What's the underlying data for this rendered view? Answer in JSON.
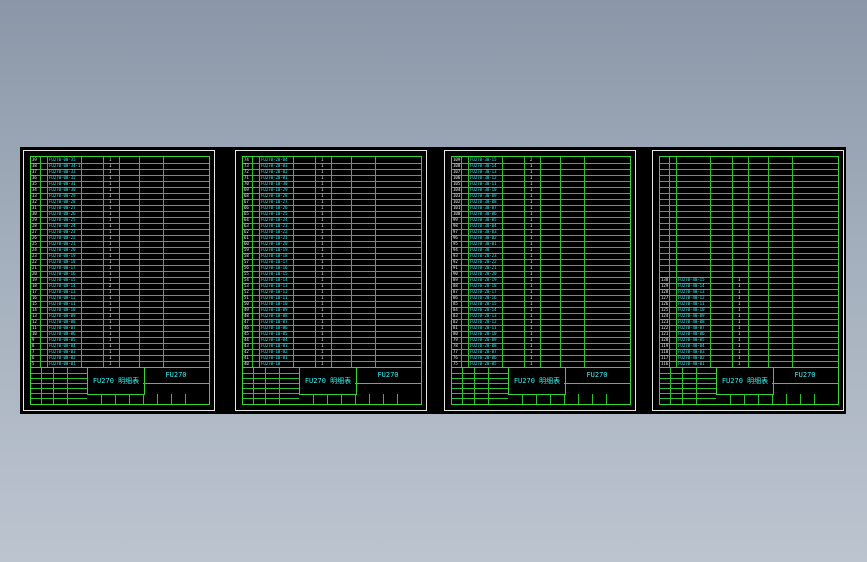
{
  "sheets": [
    {
      "title": "FU270 明细表",
      "code": "FU270",
      "rows": [
        {
          "no": "39",
          "code": "FU270-00-35",
          "name": "",
          "qty": "1"
        },
        {
          "no": "38",
          "code": "FU270-00-34-1",
          "name": "",
          "qty": "1"
        },
        {
          "no": "37",
          "code": "FU270-00-33",
          "name": "",
          "qty": "1"
        },
        {
          "no": "36",
          "code": "FU270-00-32",
          "name": "",
          "qty": "1"
        },
        {
          "no": "35",
          "code": "FU270-00-31",
          "name": "",
          "qty": "1"
        },
        {
          "no": "34",
          "code": "FU270-00-30",
          "name": "",
          "qty": "1"
        },
        {
          "no": "33",
          "code": "FU270-00-29",
          "name": "",
          "qty": "1"
        },
        {
          "no": "32",
          "code": "FU270-00-28",
          "name": "",
          "qty": "1"
        },
        {
          "no": "31",
          "code": "FU270-00-27",
          "name": "",
          "qty": "1"
        },
        {
          "no": "30",
          "code": "FU270-00-26",
          "name": "",
          "qty": "1"
        },
        {
          "no": "29",
          "code": "FU270-00-25",
          "name": "",
          "qty": "1"
        },
        {
          "no": "28",
          "code": "FU270-00-24",
          "name": "",
          "qty": "1"
        },
        {
          "no": "27",
          "code": "FU270-00-23",
          "name": "",
          "qty": "1"
        },
        {
          "no": "26",
          "code": "FU270-00-22",
          "name": "",
          "qty": "1"
        },
        {
          "no": "25",
          "code": "FU270-00-21",
          "name": "",
          "qty": "1"
        },
        {
          "no": "24",
          "code": "FU270-00-20",
          "name": "",
          "qty": "1"
        },
        {
          "no": "23",
          "code": "FU270-00-19",
          "name": "",
          "qty": "1"
        },
        {
          "no": "22",
          "code": "FU270-00-18",
          "name": "",
          "qty": "1"
        },
        {
          "no": "21",
          "code": "FU270-00-17",
          "name": "",
          "qty": "1"
        },
        {
          "no": "20",
          "code": "FU270-00-16",
          "name": "",
          "qty": "1"
        },
        {
          "no": "19",
          "code": "FU270-00-15",
          "name": "",
          "qty": "1"
        },
        {
          "no": "18",
          "code": "FU270-00-14",
          "name": "",
          "qty": "2"
        },
        {
          "no": "17",
          "code": "FU270-00-13",
          "name": "",
          "qty": "1"
        },
        {
          "no": "16",
          "code": "FU270-00-12",
          "name": "",
          "qty": "1"
        },
        {
          "no": "15",
          "code": "FU270-00-11",
          "name": "",
          "qty": "1"
        },
        {
          "no": "14",
          "code": "FU270-00-10",
          "name": "",
          "qty": "1"
        },
        {
          "no": "13",
          "code": "FU270-00-09",
          "name": "",
          "qty": "1"
        },
        {
          "no": "12",
          "code": "FU270-00-08",
          "name": "",
          "qty": "1"
        },
        {
          "no": "11",
          "code": "FU270-00-07",
          "name": "",
          "qty": "1"
        },
        {
          "no": "10",
          "code": "FU270-00-06",
          "name": "",
          "qty": "1"
        },
        {
          "no": "9",
          "code": "FU270-00-05",
          "name": "",
          "qty": "1"
        },
        {
          "no": "8",
          "code": "FU270-00-04",
          "name": "",
          "qty": "1"
        },
        {
          "no": "7",
          "code": "FU270-00-03",
          "name": "",
          "qty": "1"
        },
        {
          "no": "6",
          "code": "FU270-00-02",
          "name": "",
          "qty": "1"
        },
        {
          "no": "5",
          "code": "FU270-00-01",
          "name": "",
          "qty": "1"
        }
      ]
    },
    {
      "title": "FU270 明细表",
      "code": "FU270",
      "rows": [
        {
          "no": "74",
          "code": "FU270-20-04",
          "name": "",
          "qty": "1"
        },
        {
          "no": "73",
          "code": "FU270-20-03",
          "name": "",
          "qty": "1"
        },
        {
          "no": "72",
          "code": "FU270-20-02",
          "name": "",
          "qty": "1"
        },
        {
          "no": "71",
          "code": "FU270-20-01",
          "name": "",
          "qty": "1"
        },
        {
          "no": "70",
          "code": "FU270-10-30",
          "name": "",
          "qty": "1"
        },
        {
          "no": "69",
          "code": "FU270-10-29",
          "name": "",
          "qty": "1"
        },
        {
          "no": "68",
          "code": "FU270-10-28",
          "name": "",
          "qty": "1"
        },
        {
          "no": "67",
          "code": "FU270-10-27",
          "name": "",
          "qty": "1"
        },
        {
          "no": "66",
          "code": "FU270-10-26",
          "name": "",
          "qty": "1"
        },
        {
          "no": "65",
          "code": "FU270-10-25",
          "name": "",
          "qty": "1"
        },
        {
          "no": "64",
          "code": "FU270-10-24",
          "name": "",
          "qty": "1"
        },
        {
          "no": "63",
          "code": "FU270-10-23",
          "name": "",
          "qty": "1"
        },
        {
          "no": "62",
          "code": "FU270-10-22",
          "name": "",
          "qty": "1"
        },
        {
          "no": "61",
          "code": "FU270-10-21",
          "name": "",
          "qty": "1"
        },
        {
          "no": "60",
          "code": "FU270-10-20",
          "name": "",
          "qty": "1"
        },
        {
          "no": "59",
          "code": "FU270-10-19",
          "name": "",
          "qty": "1"
        },
        {
          "no": "58",
          "code": "FU270-10-18",
          "name": "",
          "qty": "1"
        },
        {
          "no": "57",
          "code": "FU270-10-17",
          "name": "",
          "qty": "1"
        },
        {
          "no": "56",
          "code": "FU270-10-16",
          "name": "",
          "qty": "1"
        },
        {
          "no": "55",
          "code": "FU270-10-15",
          "name": "",
          "qty": "1"
        },
        {
          "no": "54",
          "code": "FU270-10-14",
          "name": "",
          "qty": "1"
        },
        {
          "no": "53",
          "code": "FU270-10-13",
          "name": "",
          "qty": "1"
        },
        {
          "no": "52",
          "code": "FU270-10-12",
          "name": "",
          "qty": "1"
        },
        {
          "no": "51",
          "code": "FU270-10-11",
          "name": "",
          "qty": "1"
        },
        {
          "no": "50",
          "code": "FU270-10-10",
          "name": "",
          "qty": "1"
        },
        {
          "no": "49",
          "code": "FU270-10-09",
          "name": "",
          "qty": "1"
        },
        {
          "no": "48",
          "code": "FU270-10-08",
          "name": "",
          "qty": "1"
        },
        {
          "no": "47",
          "code": "FU270-10-07",
          "name": "",
          "qty": "1"
        },
        {
          "no": "46",
          "code": "FU270-10-06",
          "name": "",
          "qty": "1"
        },
        {
          "no": "45",
          "code": "FU270-10-05",
          "name": "",
          "qty": "1"
        },
        {
          "no": "44",
          "code": "FU270-10-04",
          "name": "",
          "qty": "1"
        },
        {
          "no": "43",
          "code": "FU270-10-03",
          "name": "",
          "qty": "1"
        },
        {
          "no": "42",
          "code": "FU270-10-02",
          "name": "",
          "qty": "1"
        },
        {
          "no": "41",
          "code": "FU270-10-01",
          "name": "",
          "qty": "1"
        },
        {
          "no": "40",
          "code": "FU270-10",
          "name": "",
          "qty": "1"
        }
      ]
    },
    {
      "title": "FU270 明细表",
      "code": "FU270",
      "rows": [
        {
          "no": "109",
          "code": "FU270-30-15",
          "name": "",
          "qty": "2"
        },
        {
          "no": "108",
          "code": "FU270-30-14",
          "name": "",
          "qty": "1"
        },
        {
          "no": "107",
          "code": "FU270-30-13",
          "name": "",
          "qty": "1"
        },
        {
          "no": "106",
          "code": "FU270-30-12",
          "name": "",
          "qty": "1"
        },
        {
          "no": "105",
          "code": "FU270-30-11",
          "name": "",
          "qty": "1"
        },
        {
          "no": "104",
          "code": "FU270-30-10",
          "name": "",
          "qty": "1"
        },
        {
          "no": "103",
          "code": "FU270-30-09",
          "name": "",
          "qty": "1"
        },
        {
          "no": "102",
          "code": "FU270-30-08",
          "name": "",
          "qty": "1"
        },
        {
          "no": "101",
          "code": "FU270-30-07",
          "name": "",
          "qty": "1"
        },
        {
          "no": "100",
          "code": "FU270-30-06",
          "name": "",
          "qty": "1"
        },
        {
          "no": "99",
          "code": "FU270-30-05",
          "name": "",
          "qty": "1"
        },
        {
          "no": "98",
          "code": "FU270-30-04",
          "name": "",
          "qty": "1"
        },
        {
          "no": "97",
          "code": "FU270-30-03",
          "name": "",
          "qty": "1"
        },
        {
          "no": "96",
          "code": "FU270-30-02",
          "name": "",
          "qty": "1"
        },
        {
          "no": "95",
          "code": "FU270-30-01",
          "name": "",
          "qty": "1"
        },
        {
          "no": "94",
          "code": "FU270-30",
          "name": "",
          "qty": "1"
        },
        {
          "no": "93",
          "code": "FU270-20-23",
          "name": "",
          "qty": "1"
        },
        {
          "no": "92",
          "code": "FU270-20-22",
          "name": "",
          "qty": "1"
        },
        {
          "no": "91",
          "code": "FU270-20-21",
          "name": "",
          "qty": "1"
        },
        {
          "no": "90",
          "code": "FU270-20-20",
          "name": "",
          "qty": "1"
        },
        {
          "no": "89",
          "code": "FU270-20-19",
          "name": "",
          "qty": "1"
        },
        {
          "no": "88",
          "code": "FU270-20-18",
          "name": "",
          "qty": "1"
        },
        {
          "no": "87",
          "code": "FU270-20-17",
          "name": "",
          "qty": "1"
        },
        {
          "no": "86",
          "code": "FU270-20-16",
          "name": "",
          "qty": "1"
        },
        {
          "no": "85",
          "code": "FU270-20-15",
          "name": "",
          "qty": "1"
        },
        {
          "no": "84",
          "code": "FU270-20-14",
          "name": "",
          "qty": "1"
        },
        {
          "no": "83",
          "code": "FU270-20-13",
          "name": "",
          "qty": "1"
        },
        {
          "no": "82",
          "code": "FU270-20-12",
          "name": "",
          "qty": "1"
        },
        {
          "no": "81",
          "code": "FU270-20-11",
          "name": "",
          "qty": "1"
        },
        {
          "no": "80",
          "code": "FU270-20-10",
          "name": "",
          "qty": "1"
        },
        {
          "no": "79",
          "code": "FU270-20-09",
          "name": "",
          "qty": "1"
        },
        {
          "no": "78",
          "code": "FU270-20-08",
          "name": "",
          "qty": "1"
        },
        {
          "no": "77",
          "code": "FU270-20-07",
          "name": "",
          "qty": "1"
        },
        {
          "no": "76",
          "code": "FU270-20-06",
          "name": "",
          "qty": "1"
        },
        {
          "no": "75",
          "code": "FU270-20-05",
          "name": "",
          "qty": "1"
        }
      ]
    },
    {
      "title": "FU270 明细表",
      "code": "FU270",
      "rows": [
        {
          "no": "",
          "code": "",
          "name": "",
          "qty": ""
        },
        {
          "no": "",
          "code": "",
          "name": "",
          "qty": ""
        },
        {
          "no": "",
          "code": "",
          "name": "",
          "qty": ""
        },
        {
          "no": "",
          "code": "",
          "name": "",
          "qty": ""
        },
        {
          "no": "",
          "code": "",
          "name": "",
          "qty": ""
        },
        {
          "no": "",
          "code": "",
          "name": "",
          "qty": ""
        },
        {
          "no": "",
          "code": "",
          "name": "",
          "qty": ""
        },
        {
          "no": "",
          "code": "",
          "name": "",
          "qty": ""
        },
        {
          "no": "",
          "code": "",
          "name": "",
          "qty": ""
        },
        {
          "no": "",
          "code": "",
          "name": "",
          "qty": ""
        },
        {
          "no": "",
          "code": "",
          "name": "",
          "qty": ""
        },
        {
          "no": "",
          "code": "",
          "name": "",
          "qty": ""
        },
        {
          "no": "",
          "code": "",
          "name": "",
          "qty": ""
        },
        {
          "no": "",
          "code": "",
          "name": "",
          "qty": ""
        },
        {
          "no": "",
          "code": "",
          "name": "",
          "qty": ""
        },
        {
          "no": "",
          "code": "",
          "name": "",
          "qty": ""
        },
        {
          "no": "",
          "code": "",
          "name": "",
          "qty": ""
        },
        {
          "no": "",
          "code": "",
          "name": "",
          "qty": ""
        },
        {
          "no": "",
          "code": "",
          "name": "",
          "qty": ""
        },
        {
          "no": "",
          "code": "",
          "name": "",
          "qty": ""
        },
        {
          "no": "130",
          "code": "FU270-40-15",
          "name": "",
          "qty": "1"
        },
        {
          "no": "129",
          "code": "FU270-40-14",
          "name": "",
          "qty": "1"
        },
        {
          "no": "128",
          "code": "FU270-40-13",
          "name": "",
          "qty": "1"
        },
        {
          "no": "127",
          "code": "FU270-40-12",
          "name": "",
          "qty": "1"
        },
        {
          "no": "126",
          "code": "FU270-40-11",
          "name": "",
          "qty": "1"
        },
        {
          "no": "125",
          "code": "FU270-40-10",
          "name": "",
          "qty": "1"
        },
        {
          "no": "124",
          "code": "FU270-40-09",
          "name": "",
          "qty": "1"
        },
        {
          "no": "123",
          "code": "FU270-40-08",
          "name": "",
          "qty": "1"
        },
        {
          "no": "122",
          "code": "FU270-40-07",
          "name": "",
          "qty": "1"
        },
        {
          "no": "121",
          "code": "FU270-40-06",
          "name": "",
          "qty": "1"
        },
        {
          "no": "120",
          "code": "FU270-40-05",
          "name": "",
          "qty": "1"
        },
        {
          "no": "119",
          "code": "FU270-40-04",
          "name": "",
          "qty": "1"
        },
        {
          "no": "118",
          "code": "FU270-40-03",
          "name": "",
          "qty": "1"
        },
        {
          "no": "117",
          "code": "FU270-40-02",
          "name": "",
          "qty": "1"
        },
        {
          "no": "116",
          "code": "FU270-40-01",
          "name": "",
          "qty": "1"
        }
      ]
    }
  ]
}
